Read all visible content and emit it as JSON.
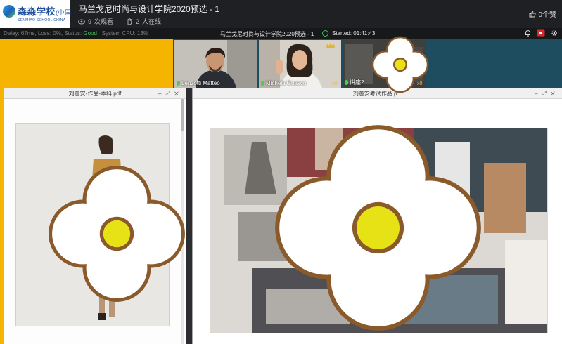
{
  "header": {
    "logo_title": "森淼学校",
    "logo_country": "(中国",
    "logo_sub": "SENMIAO SCHOOL CHINA",
    "live_title": "马兰戈尼时尚与设计学院2020预选 - 1",
    "views_count": "9",
    "views_label": "次观看",
    "online_count": "2",
    "online_label": "人在线",
    "likes_label": "0个赞"
  },
  "status_bar": {
    "stats_prefix": "Delay: 67ms, Loss: 0%, Status: ",
    "status_value": "Good",
    "cpu_text": "System CPU: 13%",
    "room_title": "马兰戈尼时尚与设计学院2020预选 - 1",
    "started_text": "Started: 01:41:43"
  },
  "participants": [
    {
      "name": "Lenzotti Matteo"
    },
    {
      "name": "Michela Guasco",
      "badge": "x0"
    },
    {
      "name": "讲座2",
      "badge": "x0"
    }
  ],
  "windows": {
    "pdf_title": "刘蕙安-作品-本科.pdf",
    "exam_title": "刘蕙安考试作品.p..."
  },
  "colors": {
    "accent_yellow": "#f5b400",
    "strip_teal": "#1e4d60",
    "good_green": "#3fbf50",
    "flower_fill": "#ffffff",
    "flower_outline": "#8b5a2b",
    "flower_center": "#e7e215"
  }
}
